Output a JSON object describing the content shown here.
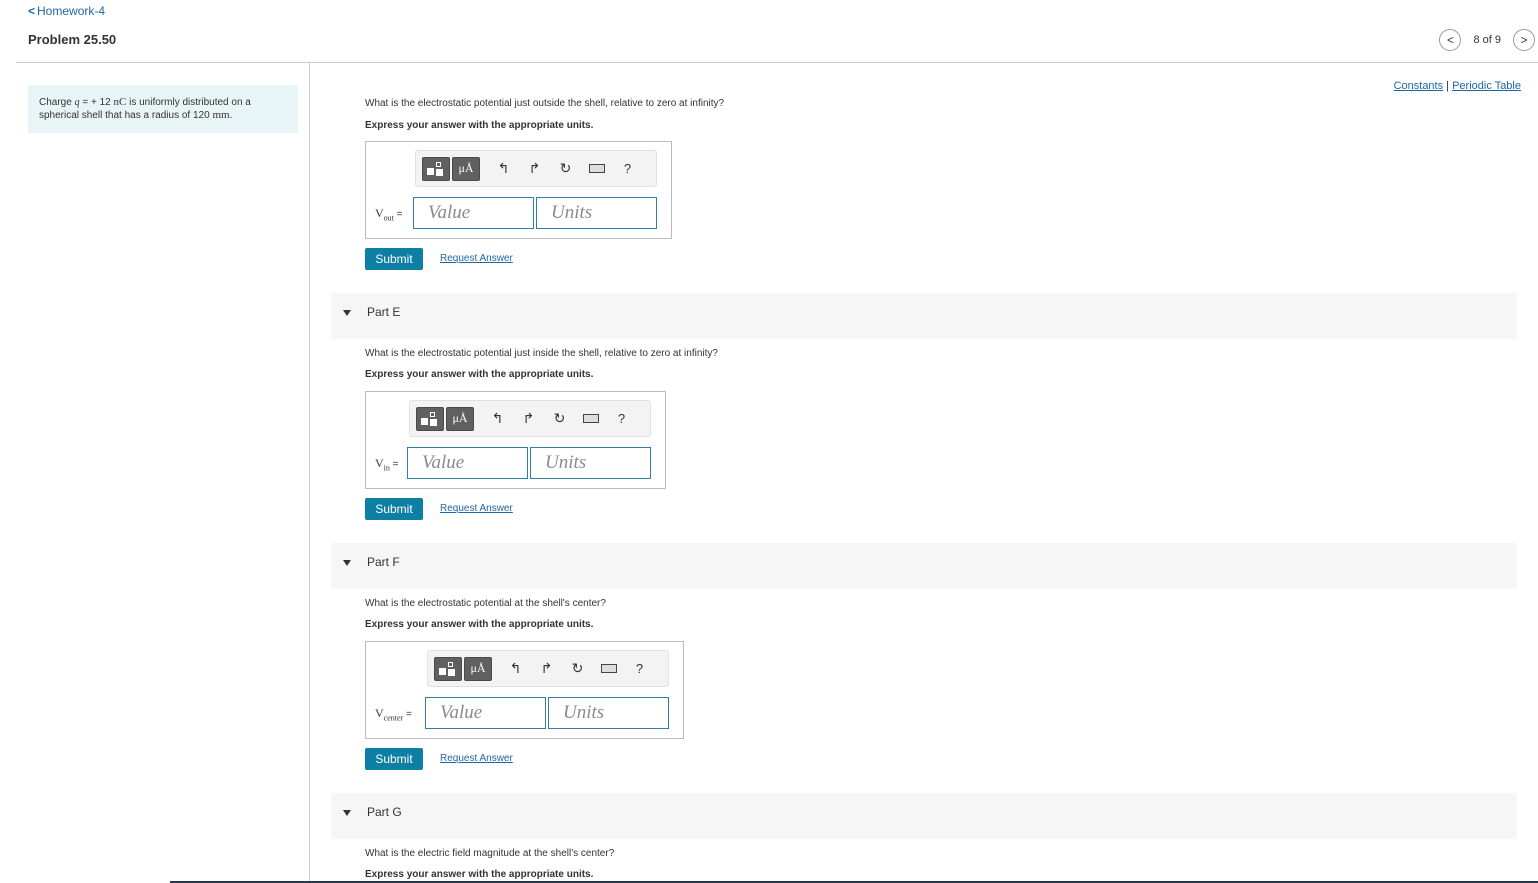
{
  "header": {
    "back_label": "Homework-4",
    "problem_title": "Problem 25.50",
    "pager_text": "8 of 9",
    "prev_icon": "chevron-left-icon",
    "next_icon": "chevron-right-icon"
  },
  "intro": {
    "prefix": "Charge ",
    "var": "q",
    "eq": " = + 12 ",
    "unit": "nC",
    "middle": " is uniformly distributed on a spherical shell that has a radius of 120 ",
    "radius_unit": "mm",
    "suffix": "."
  },
  "links": {
    "constants": "Constants",
    "separator": " | ",
    "periodic_table": "Periodic Table"
  },
  "toolbar": {
    "templates_icon": "templates-icon",
    "mu_label": "μÅ",
    "undo_icon": "undo-icon",
    "redo_icon": "redo-icon",
    "reset_icon": "reset-icon",
    "keyboard_icon": "keyboard-icon",
    "help_label": "?"
  },
  "common": {
    "instruction": "Express your answer with the appropriate units.",
    "value_placeholder": "Value",
    "units_placeholder": "Units",
    "submit": "Submit",
    "request_answer": "Request Answer",
    "equals": " ="
  },
  "parts": [
    {
      "label": "",
      "question": "What is the electrostatic potential just outside the shell, relative to zero at infinity?",
      "var_main": "V",
      "var_sub": "out"
    },
    {
      "label": "Part E",
      "question": "What is the electrostatic potential just inside the shell, relative to zero at infinity?",
      "var_main": "V",
      "var_sub": "in"
    },
    {
      "label": "Part F",
      "question": "What is the electrostatic potential at the shell's center?",
      "var_main": "V",
      "var_sub": "center"
    },
    {
      "label": "Part G",
      "question": "What is the electric field magnitude at the shell's center?"
    }
  ]
}
